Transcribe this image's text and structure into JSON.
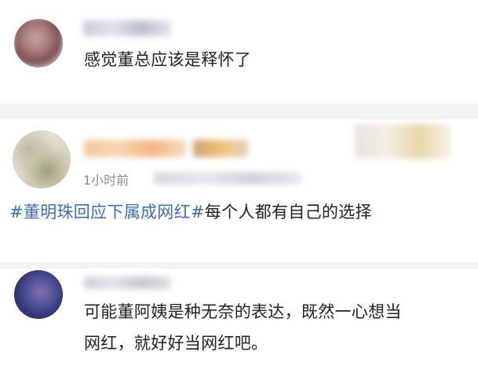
{
  "comments": [
    {
      "text": "感觉董总应该是释怀了"
    },
    {
      "time": "1小时前",
      "hashtag": "#董明珠回应下属成网红#",
      "text": "每个人都有自己的选择"
    },
    {
      "line1": "可能董阿姨是种无奈的表达，既然一心想当",
      "line2": "网红，就好好当网红吧。"
    }
  ]
}
